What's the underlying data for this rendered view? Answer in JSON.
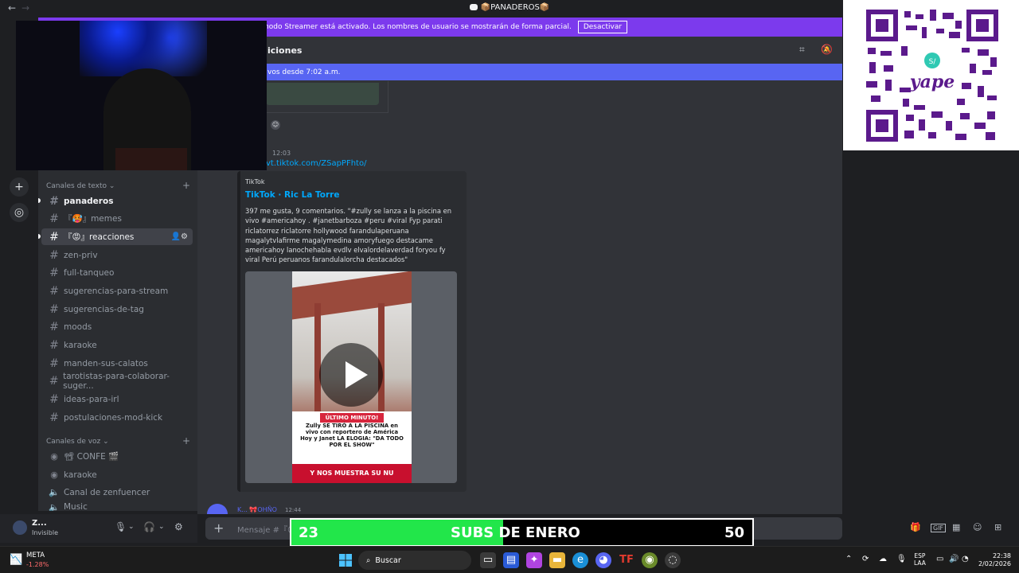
{
  "titlebar": {
    "title": "📦PANADEROS📦",
    "back": "←",
    "forward": "→"
  },
  "streamer": {
    "message": "El modo Streamer está activado. Los nombres de usuario se mostrarán de forma parcial.",
    "button": "Desactivar"
  },
  "channel_header": {
    "title": "iciones",
    "new_messages": "vos desde 7:02 a.m."
  },
  "sidebar": {
    "text_category": "Canales de texto",
    "voice_category": "Canales de voz",
    "text_channels": [
      {
        "label": "panaderos"
      },
      {
        "label": "『🥵』memes"
      },
      {
        "label": "『😡』reacciones"
      },
      {
        "label": "zen-priv"
      },
      {
        "label": "full-tanqueo"
      },
      {
        "label": "sugerencias-para-stream"
      },
      {
        "label": "sugerencias-de-tag"
      },
      {
        "label": "moods"
      },
      {
        "label": "karaoke"
      },
      {
        "label": "manden-sus-calatos"
      },
      {
        "label": "tarotistas-para-colaborar-suger..."
      },
      {
        "label": "ideas-para-irl"
      },
      {
        "label": "postulaciones-mod-kick"
      }
    ],
    "voice_channels": [
      {
        "label": "📽 CONFE 🎬"
      },
      {
        "label": "karaoke"
      },
      {
        "label": "Canal de zenfuencer"
      },
      {
        "label": "Music"
      }
    ]
  },
  "user": {
    "name": "Z...",
    "status": "Invisible"
  },
  "messages": {
    "time": "12:03",
    "link": "vt.tiktok.com/ZSapPFhto/",
    "embed": {
      "provider": "TikTok",
      "title": "TikTok · Ric La Torre",
      "description": "397 me gusta, 9 comentarios. \"#zully se lanza a la piscina en vivo #americahoy . #janetbarboza #peru #viral Fyp parati riclatorrez riclatorre hollywood farandulaperuana magalytvlafirme magalymedina amoryfuego destacame americahoy lanochehabla evdlv elvalordelaverdad foryou fy viral Perú peruanos farandulalorcha destacados\"",
      "video_top": "ÚLTIMO MINUTO!",
      "video_headline": "Zully SE TIRÓ A LA PISCINA en vivo con reportero de América Hoy y Janet LA ELOGIA: \"DA TODO POR EL SHOW\"",
      "video_bottom": "Y NOS MUESTRA SU NU"
    },
    "next_author": "K... 🎀OHÑO",
    "next_time": "12:44"
  },
  "composer": {
    "placeholder": "Mensaje #『😡"
  },
  "subs_goal": {
    "current": 23,
    "goal": 50,
    "label": "SUBS DE ENERO",
    "count_text": "23",
    "goal_text": "50"
  },
  "taskbar": {
    "stock_name": "META",
    "stock_change": "-1.28%",
    "search": "Buscar",
    "lang_1": "ESP",
    "lang_2": "LAA",
    "time": "22:38",
    "date": "2/02/2026"
  },
  "colors": {
    "streamer_banner": "#7c3aed",
    "new_banner": "#5865f2",
    "subs_fill": "#22e64a",
    "link": "#00a8fc"
  }
}
